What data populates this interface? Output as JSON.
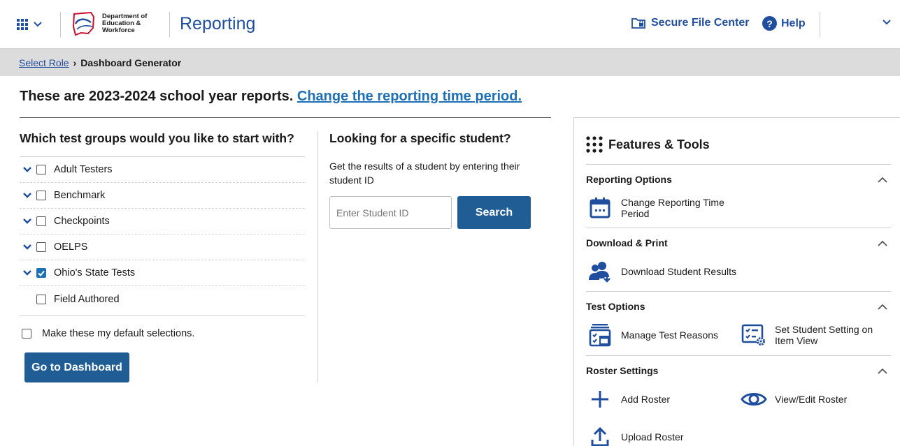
{
  "header": {
    "logo_lines": [
      "Department of",
      "Education &",
      "Workforce"
    ],
    "app_title": "Reporting",
    "secure_file_center": "Secure File Center",
    "help": "Help"
  },
  "breadcrumb": {
    "link": "Select Role",
    "current": "Dashboard Generator"
  },
  "headline": {
    "text": "These are 2023-2024 school year reports.",
    "link": "Change the reporting time period."
  },
  "test_groups": {
    "title": "Which test groups would you like to start with?",
    "items": [
      {
        "label": "Adult Testers",
        "checked": false,
        "expandable": true
      },
      {
        "label": "Benchmark",
        "checked": false,
        "expandable": true
      },
      {
        "label": "Checkpoints",
        "checked": false,
        "expandable": true
      },
      {
        "label": "OELPS",
        "checked": false,
        "expandable": true
      },
      {
        "label": "Ohio's State Tests",
        "checked": true,
        "expandable": true
      },
      {
        "label": "Field Authored",
        "checked": false,
        "expandable": false
      }
    ],
    "default_label": "Make these my default selections.",
    "go_button": "Go to Dashboard"
  },
  "student_search": {
    "title": "Looking for a specific student?",
    "description": "Get the results of a student by entering their student ID",
    "placeholder": "Enter Student ID",
    "button": "Search"
  },
  "features": {
    "title": "Features & Tools",
    "sections": [
      {
        "title": "Reporting Options",
        "tools": [
          {
            "label": "Change Reporting Time Period",
            "icon": "calendar-icon"
          }
        ]
      },
      {
        "title": "Download & Print",
        "tools": [
          {
            "label": "Download Student Results",
            "icon": "download-users-icon"
          }
        ]
      },
      {
        "title": "Test Options",
        "tools": [
          {
            "label": "Manage Test Reasons",
            "icon": "test-reasons-icon"
          },
          {
            "label": "Set Student Setting on Item View",
            "icon": "student-setting-icon"
          }
        ]
      },
      {
        "title": "Roster Settings",
        "tools": [
          {
            "label": "Add Roster",
            "icon": "plus-icon"
          },
          {
            "label": "View/Edit Roster",
            "icon": "eye-icon"
          },
          {
            "label": "Upload Roster",
            "icon": "upload-icon"
          }
        ]
      }
    ]
  },
  "colors": {
    "brand_blue": "#1f4e9e",
    "button_blue": "#1f5d94",
    "link_blue": "#1f6fb5",
    "breadcrumb_bg": "#dcdcdc"
  }
}
